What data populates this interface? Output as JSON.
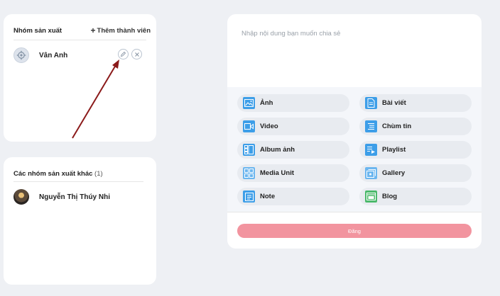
{
  "group": {
    "title": "Nhóm sản xuất",
    "add_member_label": "Thêm thành viên",
    "members": [
      {
        "name": "Vân Anh"
      }
    ]
  },
  "other_groups": {
    "title": "Các nhóm sản xuất khác",
    "count": "(1)",
    "members": [
      {
        "name": "Nguyễn Thị Thúy Nhi"
      }
    ]
  },
  "post": {
    "placeholder": "Nhập nội dung bạn muốn chia sẻ",
    "media_buttons": [
      {
        "label": "Ảnh",
        "icon": "image-icon"
      },
      {
        "label": "Bài viết",
        "icon": "article-icon"
      },
      {
        "label": "Video",
        "icon": "video-icon"
      },
      {
        "label": "Chùm tin",
        "icon": "news-cluster-icon"
      },
      {
        "label": "Album ảnh",
        "icon": "album-icon"
      },
      {
        "label": "Playlist",
        "icon": "playlist-icon"
      },
      {
        "label": "Media Unit",
        "icon": "media-unit-icon"
      },
      {
        "label": "Gallery",
        "icon": "gallery-icon"
      },
      {
        "label": "Note",
        "icon": "note-icon"
      },
      {
        "label": "Blog",
        "icon": "blog-icon"
      }
    ],
    "submit_label": "Đăng"
  },
  "colors": {
    "accent_blue": "#3d9ee8",
    "submit_pink": "#f2949f",
    "annotation_arrow": "#8b1a1a"
  }
}
